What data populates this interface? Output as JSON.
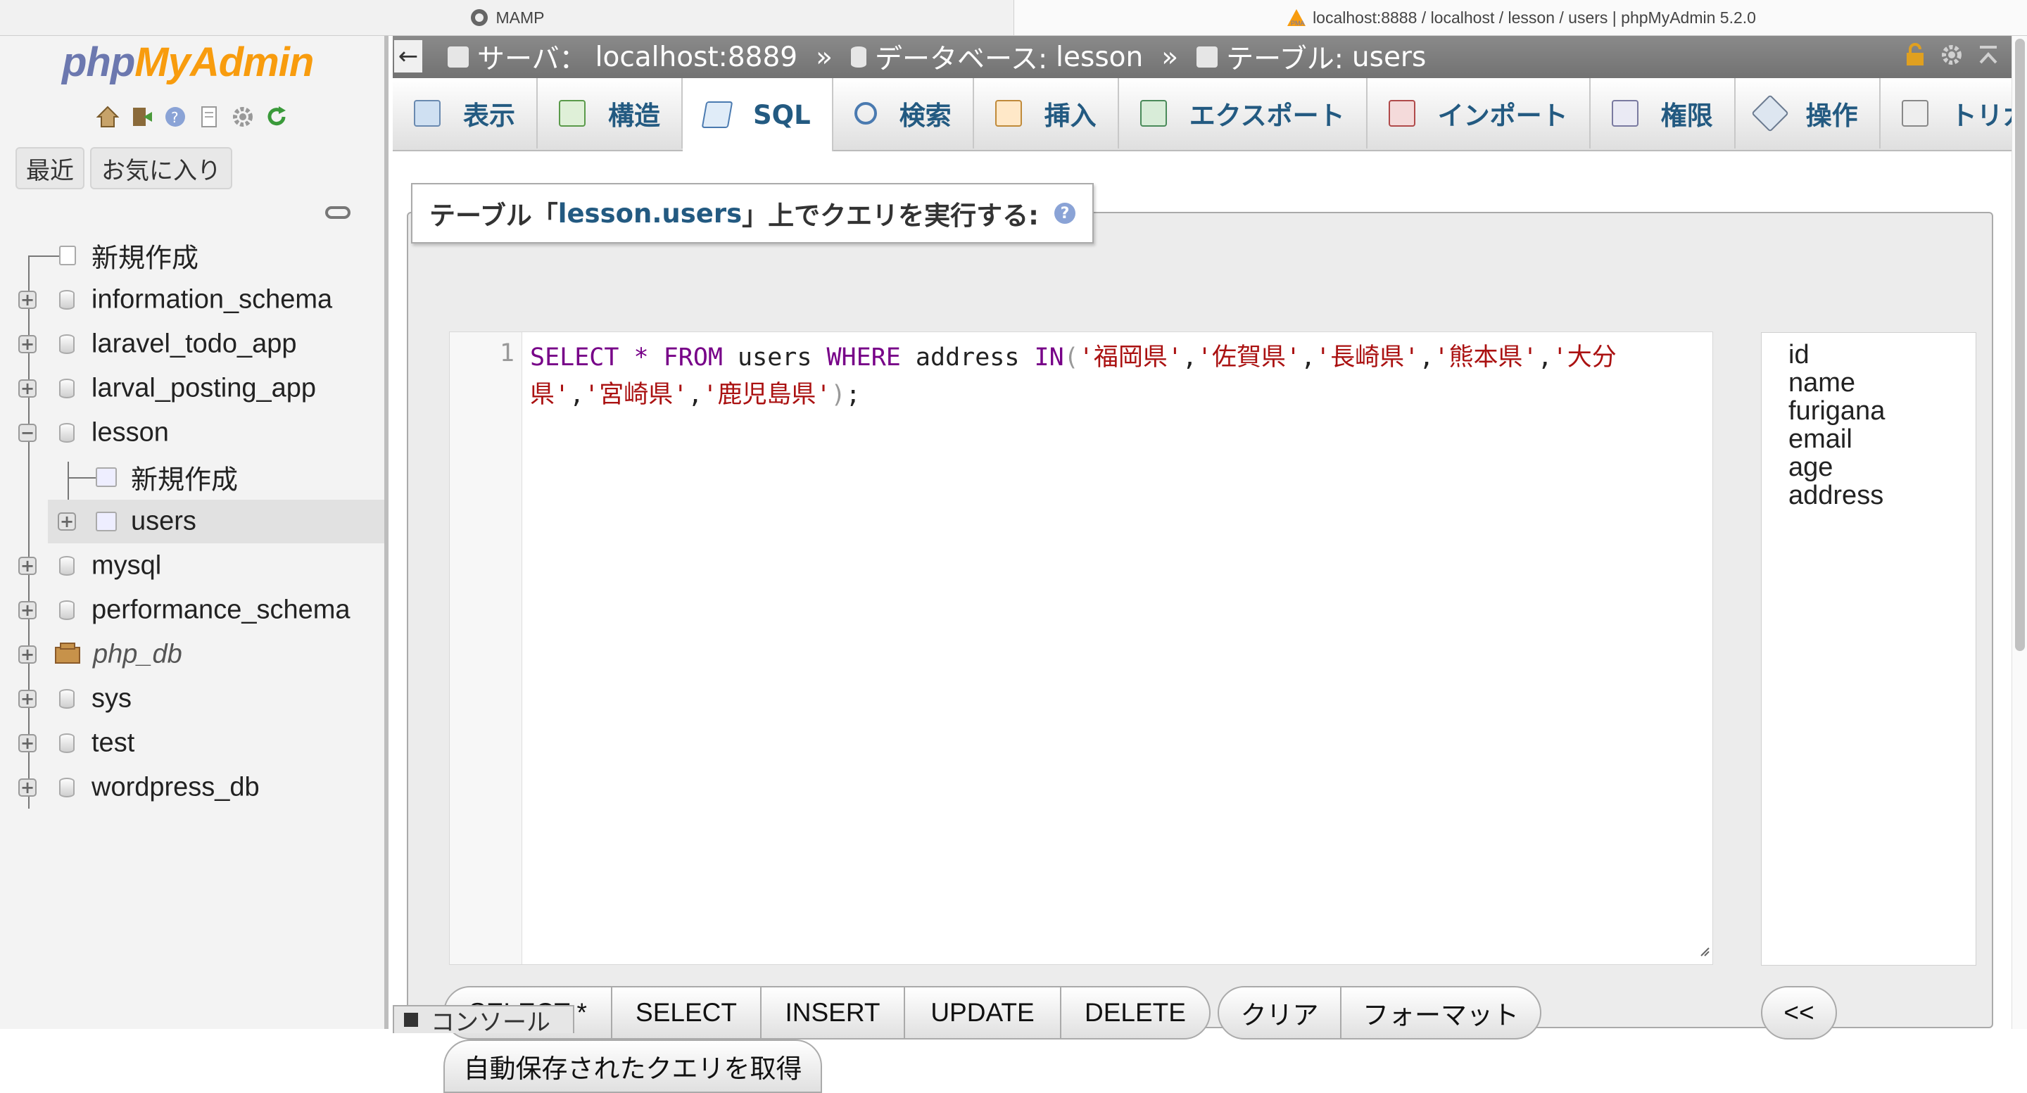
{
  "browser": {
    "tabs": [
      {
        "title": "MAMP",
        "active": false
      },
      {
        "title": "localhost:8888 / localhost / lesson / users | phpMyAdmin 5.2.0",
        "active": true
      }
    ]
  },
  "sidebar": {
    "logo": {
      "part1": "php",
      "part2": "MyAdmin"
    },
    "toolbar_icons": [
      "home-icon",
      "logout-icon",
      "help-icon",
      "docs-icon",
      "settings-icon",
      "reload-icon"
    ],
    "buttons": {
      "recent": "最近",
      "favorites": "お気に入り"
    },
    "tree": {
      "new": "新規作成",
      "databases": [
        {
          "name": "information_schema"
        },
        {
          "name": "laravel_todo_app"
        },
        {
          "name": "larval_posting_app"
        },
        {
          "name": "lesson",
          "expanded": true
        },
        {
          "name": "mysql"
        },
        {
          "name": "performance_schema"
        },
        {
          "name": "php_db"
        },
        {
          "name": "sys"
        },
        {
          "name": "test"
        },
        {
          "name": "wordpress_db"
        }
      ],
      "lesson_children": {
        "new": "新規作成",
        "table": "users"
      }
    }
  },
  "breadcrumb": {
    "server_label": "サーバ：",
    "server": "localhost:8889",
    "db_label": "データベース:",
    "db": "lesson",
    "table_label": "テーブル:",
    "table": "users",
    "separator": "»"
  },
  "tabs": [
    {
      "label": "表示",
      "icon": "browse-icon"
    },
    {
      "label": "構造",
      "icon": "structure-icon"
    },
    {
      "label": "SQL",
      "icon": "sql-icon",
      "active": true
    },
    {
      "label": "検索",
      "icon": "search-icon"
    },
    {
      "label": "挿入",
      "icon": "insert-icon"
    },
    {
      "label": "エクスポート",
      "icon": "export-icon"
    },
    {
      "label": "インポート",
      "icon": "import-icon"
    },
    {
      "label": "権限",
      "icon": "privileges-icon"
    },
    {
      "label": "操作",
      "icon": "operations-icon"
    },
    {
      "label": "トリガ",
      "icon": "triggers-icon"
    }
  ],
  "query_box": {
    "legend_prefix": "テーブル「",
    "legend_table": "lesson.users",
    "legend_suffix": "」上でクエリを実行する:",
    "line_number": "1",
    "code": {
      "kw_select": "SELECT",
      "star": "*",
      "kw_from": "FROM",
      "table": "users",
      "kw_where": "WHERE",
      "column": "address",
      "kw_in": "IN",
      "values": [
        "'福岡県'",
        "'佐賀県'",
        "'長崎県'",
        "'熊本県'",
        "'大分県'",
        "'宮崎県'",
        "'鹿児島県'"
      ]
    }
  },
  "columns": [
    "id",
    "name",
    "furigana",
    "email",
    "age",
    "address"
  ],
  "buttons": {
    "select_star": "SELECT *",
    "select": "SELECT",
    "insert": "INSERT",
    "update": "UPDATE",
    "delete": "DELETE",
    "clear": "クリア",
    "format": "フォーマット",
    "insert_column": "<<",
    "get_autosaved": "自動保存されたクエリを取得"
  },
  "console": {
    "label": "コンソール"
  }
}
